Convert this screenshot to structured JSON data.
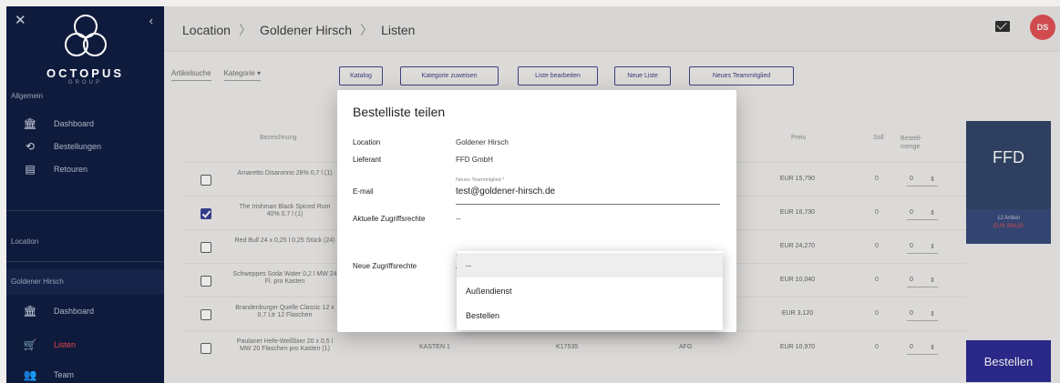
{
  "sidebar": {
    "brand": "OCTOPUS",
    "brand_sub": "GROUP",
    "section_general": "Allgemein",
    "general_items": [
      {
        "label": "Dashboard",
        "icon": "bank-icon"
      },
      {
        "label": "Bestellungen",
        "icon": "history-icon"
      },
      {
        "label": "Retouren",
        "icon": "archive-icon"
      }
    ],
    "section_location": "Location",
    "location_name": "Goldener Hirsch",
    "location_items": [
      {
        "label": "Dashboard",
        "icon": "bank-icon"
      },
      {
        "label": "Listen",
        "icon": "cart-icon",
        "active": true
      },
      {
        "label": "Team",
        "icon": "team-icon"
      }
    ]
  },
  "header": {
    "breadcrumb": [
      "Location",
      "Goldener Hirsch",
      "Listen"
    ],
    "avatar_initials": "DS"
  },
  "filters": [
    "Artikelsuche",
    "Kategorie"
  ],
  "toolbar": [
    "Katalog",
    "Kategorie zuweisen",
    "Liste bearbeiten",
    "Neue Liste",
    "Neues Teammitglied"
  ],
  "table": {
    "headers": [
      "Bezeichnung",
      "Preis",
      "Soll",
      "Bestell-menge"
    ],
    "rows": [
      {
        "checked": false,
        "name": "Amaretto Disaronno 28% 0,7 l (1)",
        "price": "EUR 15,790",
        "qty": "0",
        "order": "0"
      },
      {
        "checked": true,
        "name": "The Irishman Black Spiced Rum 40% 0,7 l (1)",
        "price": "EUR 16,730",
        "qty": "0",
        "order": "0"
      },
      {
        "checked": false,
        "name": "Red Bull 24 x 0,25 l 0,25 Stück (24)",
        "price": "EUR 24,270",
        "qty": "0",
        "order": "0"
      },
      {
        "checked": false,
        "name": "Schweppes Soda Water 0,2 l MW 24 Fl. pro Kasten",
        "price": "EUR 10,040",
        "qty": "0",
        "order": "0"
      },
      {
        "checked": false,
        "name": "Brandenburger Quelle Classic 12 x 0,7 Ltr 12 Flaschen",
        "price": "EUR 3,120",
        "qty": "0",
        "order": "0"
      },
      {
        "checked": false,
        "name": "Paulaner Hefe-Weißbier 20 x 0,5 l MW 20 Flaschen pro Kasten (1)",
        "unit": "KASTEN 1",
        "code": "K17535",
        "supplier": "AFG",
        "price": "EUR 10,970",
        "qty": "0",
        "order": "0"
      }
    ]
  },
  "supplier_panel": {
    "name": "FFD",
    "info_line1": "12 Artikel",
    "info_line2": "EUR 284,00",
    "order_label": "Bestellen"
  },
  "modal": {
    "title": "Bestelliste teilen",
    "location_label": "Location",
    "location_value": "Goldener Hirsch",
    "supplier_label": "Lieferant",
    "supplier_value": "FFD GmbH",
    "email_label": "E-mail",
    "email_small_label": "Neues Teammitglied *",
    "email_value": "test@goldener-hirsch.de",
    "current_access_label": "Aktuelle Zugriffsrechte",
    "current_access_value": "--",
    "new_access_label": "Neue Zugriffsrechte",
    "new_access_value": "--"
  },
  "dropdown": {
    "options": [
      "--",
      "Außendienst",
      "Bestellen"
    ]
  }
}
